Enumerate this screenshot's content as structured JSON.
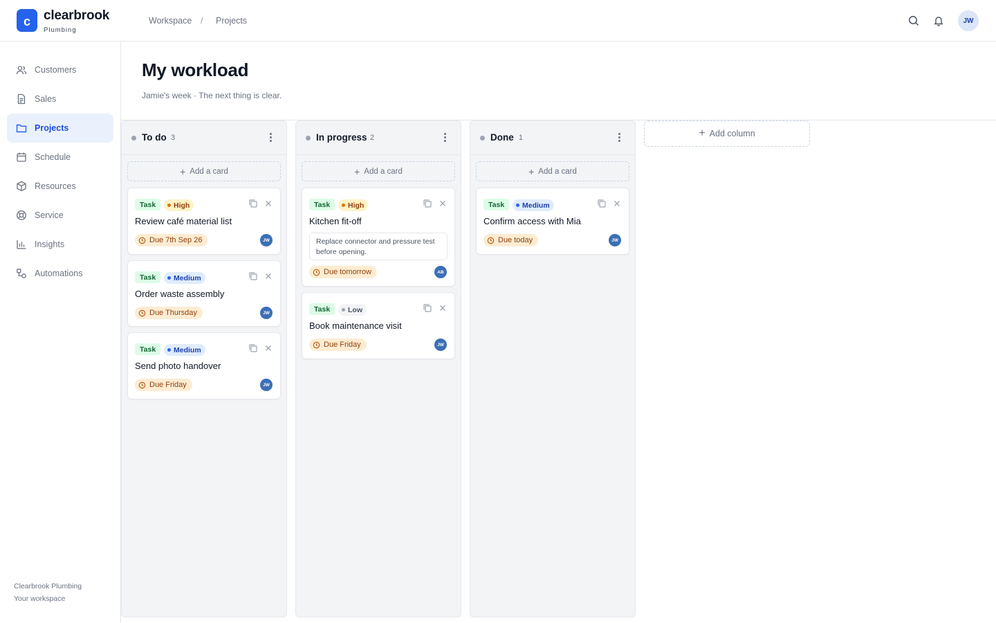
{
  "brand": {
    "mark": "c",
    "name": "clearbrook",
    "sub": "Plumbing"
  },
  "breadcrumb": {
    "items": [
      "Workspace",
      "Projects"
    ],
    "separator": "/"
  },
  "header": {
    "user_initials": "JW"
  },
  "sidebar": {
    "items": [
      {
        "label": "Customers",
        "icon": "users-icon"
      },
      {
        "label": "Sales",
        "icon": "document-icon"
      },
      {
        "label": "Projects",
        "icon": "folder-icon",
        "active": true
      },
      {
        "label": "Schedule",
        "icon": "calendar-icon"
      },
      {
        "label": "Resources",
        "icon": "box-icon"
      },
      {
        "label": "Service",
        "icon": "lifebuoy-icon"
      },
      {
        "label": "Insights",
        "icon": "bar-chart-icon"
      },
      {
        "label": "Automations",
        "icon": "automation-icon"
      }
    ],
    "footer_line1": "Clearbrook Plumbing",
    "footer_line2": "Your workspace"
  },
  "page": {
    "title": "My workload",
    "subtitle": "Jamie's week · The next thing is clear."
  },
  "board": {
    "add_card_label": "Add a card",
    "add_column_label": "Add column",
    "columns": [
      {
        "title": "To do",
        "count": "3",
        "cards": [
          {
            "type": "Task",
            "priority": "High",
            "title": "Review café material list",
            "due": "Due 7th Sep 26",
            "assignee": "JW"
          },
          {
            "type": "Task",
            "priority": "Medium",
            "title": "Order waste assembly",
            "due": "Due Thursday",
            "assignee": "JW"
          },
          {
            "type": "Task",
            "priority": "Medium",
            "title": "Send photo handover",
            "due": "Due Friday",
            "assignee": "JW"
          }
        ]
      },
      {
        "title": "In progress",
        "count": "2",
        "cards": [
          {
            "type": "Task",
            "priority": "High",
            "title": "Kitchen fit-off",
            "description": "Replace connector and pressure test before opening.",
            "due": "Due tomorrow",
            "assignee": "AB"
          },
          {
            "type": "Task",
            "priority": "Low",
            "title": "Book maintenance visit",
            "due": "Due Friday",
            "assignee": "JW"
          }
        ]
      },
      {
        "title": "Done",
        "count": "1",
        "cards": [
          {
            "type": "Task",
            "priority": "Medium",
            "title": "Confirm access with Mia",
            "due": "Due today",
            "assignee": "JW"
          }
        ]
      }
    ]
  },
  "colors": {
    "accent": "#2563eb",
    "active_nav_bg": "#eaf1fd",
    "task_tag_bg": "#dcfce7",
    "high_bg": "#fef3c7",
    "medium_bg": "#e0ecfd",
    "due_bg": "#fdecd2",
    "assignee_bg": "#3b6fb6"
  }
}
